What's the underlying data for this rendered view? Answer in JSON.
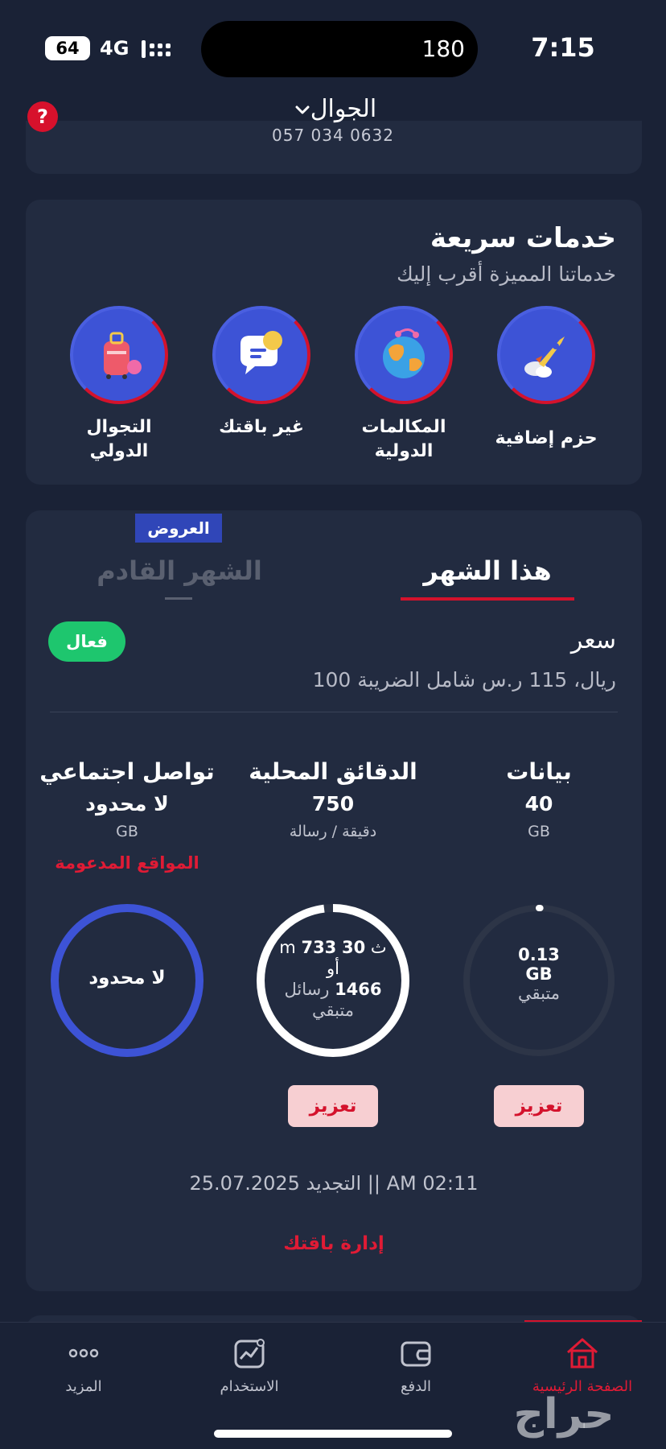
{
  "status_bar": {
    "time": "7:15",
    "battery": "64",
    "network": "4G",
    "island_counter": "180"
  },
  "header": {
    "title": "الجوال",
    "phone": "057 034 0632",
    "help_icon": "?"
  },
  "quick_services": {
    "title": "خدمات سريعة",
    "subtitle": "خدماتنا المميزة أقرب إليك",
    "items": [
      {
        "label": "حزم إضافية",
        "icon": "rocket-icon"
      },
      {
        "label": "المكالمات الدولية",
        "icon": "globe-icon"
      },
      {
        "label": "غير باقتك",
        "icon": "speech-bubble-icon"
      },
      {
        "label": "التجوال الدولي",
        "icon": "suitcase-icon"
      }
    ]
  },
  "plan": {
    "offers_badge": "العروض",
    "tab_current": "هذا الشهر",
    "tab_next": "الشهر القادم",
    "status": "فعال",
    "price_label": "سعر",
    "price_value": "100 ريال، 115 ر.س شامل الضريبة",
    "columns": [
      {
        "title": "بيانات",
        "amount": "40",
        "unit": "GB"
      },
      {
        "title": "الدقائق المحلية",
        "amount": "750",
        "unit": "دقيقة / رسالة"
      },
      {
        "title": "تواصل اجتماعي",
        "amount": "لا محدود",
        "unit": "GB"
      }
    ],
    "supported_sites": "المواقع المدعومة",
    "data_ring": {
      "value": "0.13",
      "unit": "GB",
      "caption": "متبقي",
      "remaining_fraction": 0.003
    },
    "minutes_ring": {
      "hours_unit": "ث",
      "hours": "30",
      "minutes_unit": "m",
      "minutes": "733",
      "or": "أو",
      "sms_count": "1466",
      "sms_label": "رسائل",
      "caption": "متبقي",
      "remaining_fraction": 0.98
    },
    "social_ring": {
      "label": "لا محدود"
    },
    "boost_label": "تعزيز",
    "renewal": "التجديد 25.07.2025 || AM 02:11",
    "manage_label": "إدارة باقتك"
  },
  "bottom_nav": {
    "items": [
      {
        "label": "الصفحة الرئيسية",
        "icon": "home-icon",
        "active": true
      },
      {
        "label": "الدفع",
        "icon": "wallet-icon",
        "active": false
      },
      {
        "label": "الاستخدام",
        "icon": "usage-chart-icon",
        "active": false
      },
      {
        "label": "المزيد",
        "icon": "more-dots-icon",
        "active": false
      }
    ]
  },
  "watermark": {
    "text": "حراج"
  },
  "colors": {
    "background": "#1a2236",
    "card": "#222b40",
    "accent_red": "#d4122c",
    "accent_blue": "#3d53d6",
    "active_green": "#1ec66e"
  }
}
